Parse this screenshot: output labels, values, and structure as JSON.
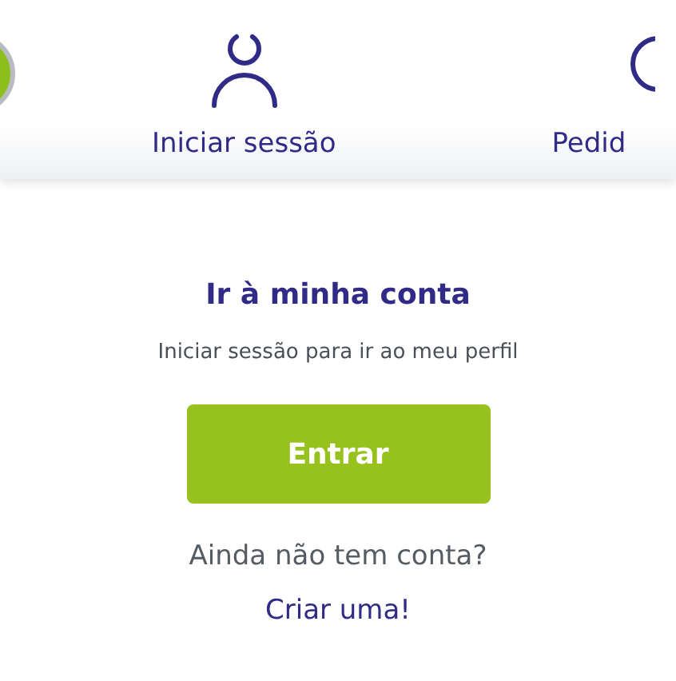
{
  "nav": {
    "items": [
      {
        "kind": "logo"
      },
      {
        "kind": "user",
        "label": "Iniciar sessão"
      },
      {
        "kind": "orders",
        "label": "Pedid"
      }
    ]
  },
  "account_card": {
    "title": "Ir à minha conta",
    "subtitle": "Iniciar sessão para ir ao meu perfil",
    "button": "Entrar",
    "prompt": "Ainda não tem conta?",
    "link": "Criar uma!"
  }
}
